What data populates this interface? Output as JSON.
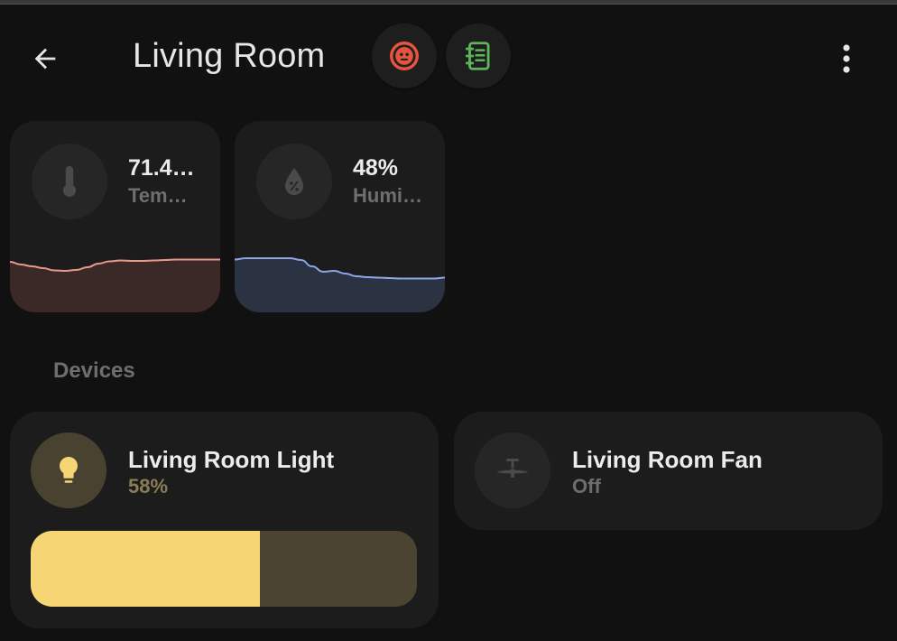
{
  "header": {
    "title": "Living Room"
  },
  "sensors": [
    {
      "value": "71.4…",
      "label": "Tem…",
      "icon": "thermometer-icon",
      "color": "#e8998a",
      "fill": "#3a2927",
      "trend": [
        0.92,
        0.86,
        0.82,
        0.78,
        0.73,
        0.72,
        0.74,
        0.8,
        0.88,
        0.93,
        0.95,
        0.94,
        0.94,
        0.95,
        0.96,
        0.97,
        0.97,
        0.97,
        0.97,
        0.97
      ]
    },
    {
      "value": "48%",
      "label": "Humi…",
      "icon": "water-percent-icon",
      "color": "#8ea6e6",
      "fill": "#2b3241",
      "trend": [
        0.97,
        1.0,
        1.0,
        1.0,
        1.0,
        1.0,
        0.96,
        0.82,
        0.7,
        0.72,
        0.66,
        0.6,
        0.58,
        0.57,
        0.56,
        0.55,
        0.55,
        0.55,
        0.55,
        0.57
      ]
    }
  ],
  "section": {
    "devices_title": "Devices"
  },
  "devices": {
    "light": {
      "name": "Living Room Light",
      "state": "58%",
      "icon": "lightbulb-icon",
      "accent": "#f5d574",
      "brightness": 0.593
    },
    "fan": {
      "name": "Living Room Fan",
      "state": "Off",
      "icon": "ceiling-fan-icon"
    }
  },
  "icons": {
    "back": "arrow-left-icon",
    "alarm": "alarm-panel-icon",
    "notes": "notebook-icon",
    "menu": "dots-vertical-icon"
  },
  "colors": {
    "background": "#111111",
    "card": "#1c1c1c",
    "alarm": "#e4543f",
    "notes": "#5db659"
  }
}
